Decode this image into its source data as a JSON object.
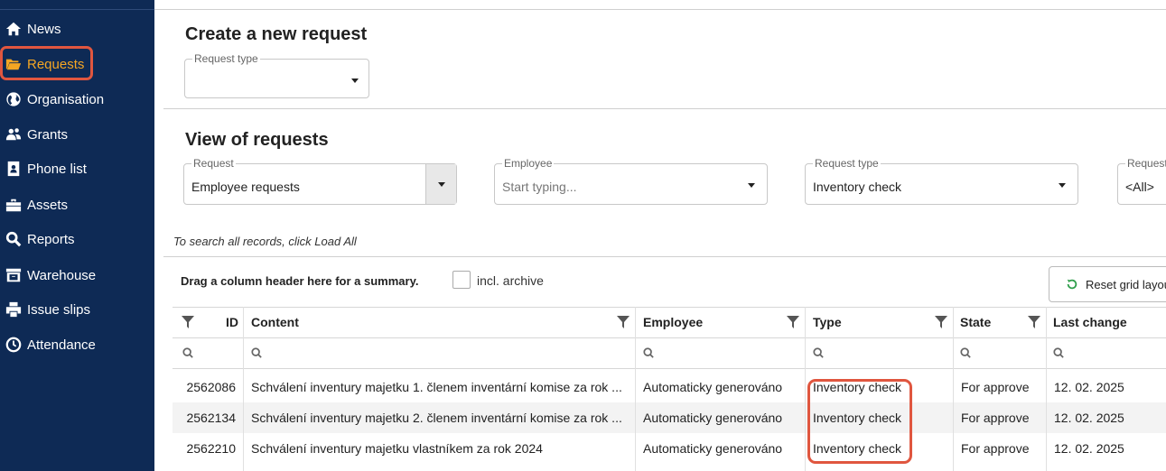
{
  "sidebar": {
    "items": [
      {
        "label": "News",
        "icon": "home-icon",
        "active": false
      },
      {
        "label": "Requests",
        "icon": "folder-open-icon",
        "active": true
      },
      {
        "label": "Organisation",
        "icon": "globe-icon",
        "active": false
      },
      {
        "label": "Grants",
        "icon": "users-icon",
        "active": false
      },
      {
        "label": "Phone list",
        "icon": "contact-card-icon",
        "active": false
      },
      {
        "label": "Assets",
        "icon": "toolbox-icon",
        "active": false
      },
      {
        "label": "Reports",
        "icon": "search-icon",
        "active": false
      },
      {
        "label": "Warehouse",
        "icon": "warehouse-icon",
        "active": false
      },
      {
        "label": "Issue slips",
        "icon": "printer-icon",
        "active": false
      },
      {
        "label": "Attendance",
        "icon": "clock-icon",
        "active": false
      }
    ]
  },
  "create": {
    "title": "Create a new request",
    "request_type_legend": "Request type",
    "request_type_value": ""
  },
  "view": {
    "title": "View of requests",
    "filters": [
      {
        "legend": "Request",
        "value": "Employee requests"
      },
      {
        "legend": "Employee",
        "placeholder": "Start typing..."
      },
      {
        "legend": "Request type",
        "value": "Inventory check"
      },
      {
        "legend": "Request",
        "value": "<All>"
      }
    ],
    "hint": "To search all records, click Load All",
    "summary_text": "Drag a column header here for a summary.",
    "incl_archive_label": "incl. archive",
    "reset_label": "Reset grid layout"
  },
  "grid": {
    "columns": [
      "ID",
      "Content",
      "Employee",
      "Type",
      "State",
      "Last change"
    ],
    "rows": [
      {
        "id": "2562086",
        "content": "Schválení inventury majetku 1. členem inventární komise za rok ...",
        "employee": "Automaticky generováno",
        "type": "Inventory check",
        "state": "For approve",
        "last_change": "12. 02. 2025"
      },
      {
        "id": "2562134",
        "content": "Schválení inventury majetku 2. členem inventární komise za rok ...",
        "employee": "Automaticky generováno",
        "type": "Inventory check",
        "state": "For approve",
        "last_change": "12. 02. 2025"
      },
      {
        "id": "2562210",
        "content": "Schválení inventury majetku vlastníkem za rok 2024",
        "employee": "Automaticky generováno",
        "type": "Inventory check",
        "state": "For approve",
        "last_change": "12. 02. 2025"
      }
    ]
  },
  "colors": {
    "sidebar_bg": "#0e2a55",
    "active": "#f5a623",
    "highlight": "#e0563f",
    "reset_icon": "#2e9d4a"
  }
}
